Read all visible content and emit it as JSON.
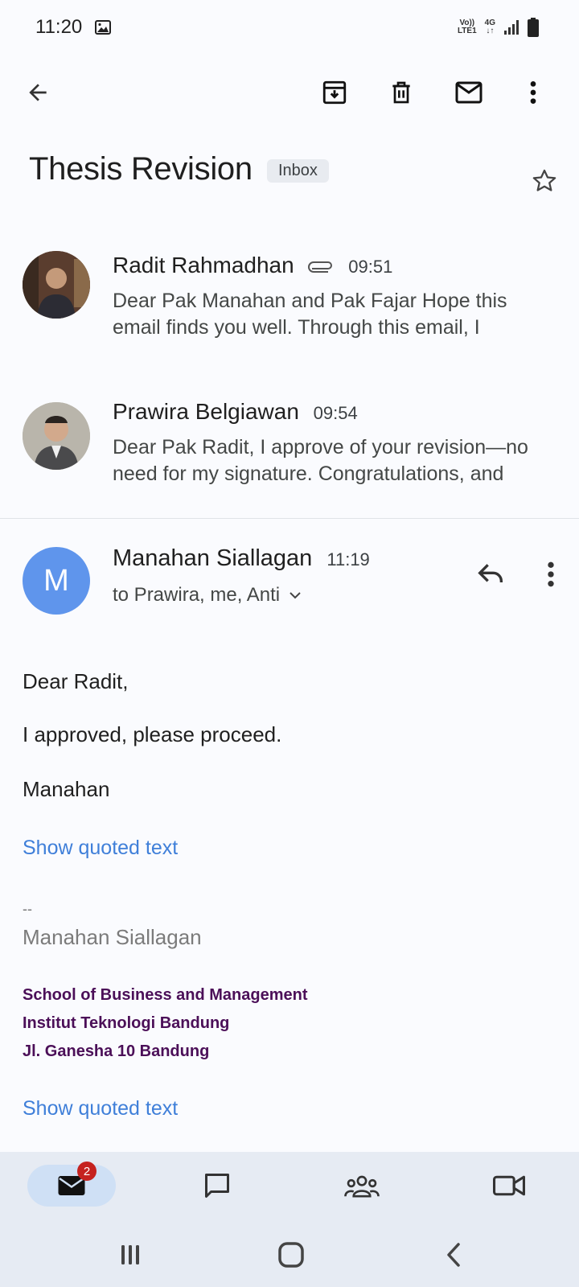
{
  "status_bar": {
    "time": "11:20",
    "volte_top": "Vo))",
    "volte_bottom": "LTE1",
    "network": "4G",
    "icons": [
      "image-icon",
      "volte-icon",
      "signal-icon",
      "battery-icon"
    ]
  },
  "toolbar": {
    "back": "back-arrow-icon",
    "actions": [
      "archive-icon",
      "delete-icon",
      "mark-unread-icon",
      "more-vert-icon"
    ]
  },
  "thread": {
    "subject": "Thesis Revision",
    "label": "Inbox"
  },
  "messages": [
    {
      "sender": "Radit Rahmadhan",
      "time": "09:51",
      "has_attachment": true,
      "snippet_line1": "Dear Pak Manahan and Pak Fajar Hope this",
      "snippet_line2": "email finds you well. Through this email, I"
    },
    {
      "sender": "Prawira Belgiawan",
      "time": "09:54",
      "has_attachment": false,
      "snippet_line1": "Dear Pak Radit, I approve of your revision—no",
      "snippet_line2": "need for my signature. Congratulations, and"
    }
  ],
  "open_message": {
    "avatar_letter": "M",
    "avatar_color": "#5f95ec",
    "sender": "Manahan Siallagan",
    "time": "11:19",
    "recipients": "to Prawira, me, Anti",
    "body": {
      "greeting": "Dear Radit,",
      "line": "I approved, please proceed.",
      "signoff": "Manahan"
    },
    "show_quoted_1": "Show quoted text",
    "signature": {
      "dash": "--",
      "name": "Manahan Siallagan",
      "org1": "School of Business and Management",
      "org2": "Institut Teknologi Bandung",
      "org3": "Jl. Ganesha 10 Bandung"
    },
    "show_quoted_2": "Show quoted text"
  },
  "bottom_nav": {
    "mail_badge": "2",
    "items": [
      "mail-icon",
      "chat-icon",
      "spaces-icon",
      "meet-icon"
    ]
  },
  "colors": {
    "accent": "#3f7fd9",
    "signature": "#4b0f58",
    "badge": "#c5221f",
    "nav_bg": "#e6ebf3"
  }
}
